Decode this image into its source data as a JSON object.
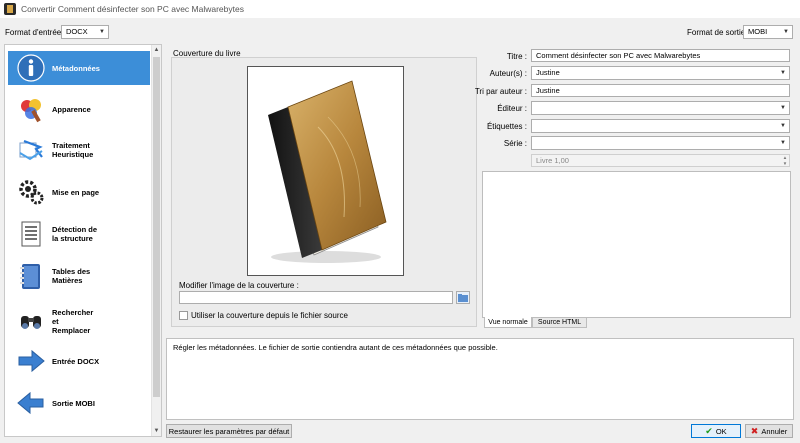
{
  "window": {
    "title": "Convertir Comment désinfecter son PC avec Malwarebytes",
    "minimize": "—",
    "maximize": "☐",
    "close": "✕"
  },
  "topbar": {
    "input_format_label": "Format d'entrée :",
    "input_format_value": "DOCX",
    "output_format_label": "Format de sortie :",
    "output_format_value": "MOBI"
  },
  "sidebar": {
    "items": [
      {
        "label": "Métadonnées",
        "icon": "info-icon"
      },
      {
        "label": "Apparence",
        "icon": "paint-icon"
      },
      {
        "label": "Traitement\nHeuristique",
        "icon": "arrows-icon"
      },
      {
        "label": "Mise en page",
        "icon": "gear-icon"
      },
      {
        "label": "Détection de\nla structure",
        "icon": "document-icon"
      },
      {
        "label": "Tables des\nMatières",
        "icon": "notebook-icon"
      },
      {
        "label": "Rechercher\net\nRemplacer",
        "icon": "binoculars-icon"
      },
      {
        "label": "Entrée DOCX",
        "icon": "arrow-right-icon"
      },
      {
        "label": "Sortie MOBI",
        "icon": "arrow-left-icon"
      }
    ]
  },
  "cover": {
    "section_label": "Couverture du livre",
    "change_label": "Modifier l'image de la couverture :",
    "path_value": "",
    "use_source_label": "Utiliser la couverture depuis le fichier source"
  },
  "metadata": {
    "title_label": "Titre :",
    "title_value": "Comment désinfecter son PC avec Malwarebytes",
    "authors_label": "Auteur(s) :",
    "authors_value": "Justine",
    "author_sort_label": "Tri par auteur :",
    "author_sort_value": "Justine",
    "publisher_label": "Éditeur :",
    "publisher_value": "",
    "tags_label": "Étiquettes :",
    "tags_value": "",
    "series_label": "Série :",
    "series_value": "",
    "series_index_value": "Livre 1,00"
  },
  "comments": {
    "tab_normal": "Vue normale",
    "tab_html": "Source HTML"
  },
  "description": "Régler les métadonnées. Le fichier de sortie contiendra autant de ces métadonnées que possible.",
  "footer": {
    "restore_label": "Restaurer les paramètres par défaut",
    "ok_label": "OK",
    "cancel_label": "Annuler",
    "help_label": "?"
  },
  "colors": {
    "accent": "#3c8ed8",
    "ok_check": "#1a9a1a",
    "cancel_x": "#d02020"
  }
}
